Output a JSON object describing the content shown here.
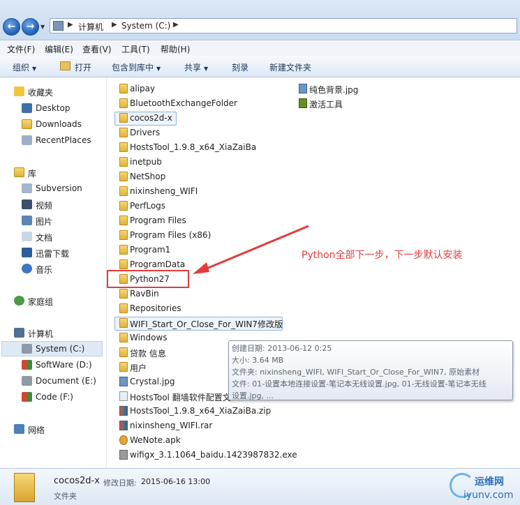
{
  "address": {
    "breadcrumbs": [
      "计算机",
      "System (C:)"
    ]
  },
  "menu": [
    "文件(F)",
    "编辑(E)",
    "查看(V)",
    "工具(T)",
    "帮助(H)"
  ],
  "commands": {
    "organize": "组织",
    "open": "打开",
    "include": "包含到库中",
    "share": "共享",
    "burn": "刻录",
    "newfolder": "新建文件夹"
  },
  "nav": {
    "favorites": "收藏夹",
    "desktop": "Desktop",
    "downloads": "Downloads",
    "recent": "RecentPlaces",
    "libraries": "库",
    "subversion": "Subversion",
    "video": "视频",
    "pictures": "图片",
    "docs": "文档",
    "xunlei": "迅雷下载",
    "music": "音乐",
    "homegroup": "家庭组",
    "computer": "计算机",
    "system": "System (C:)",
    "software": "SoftWare (D:)",
    "document": "Document (E:)",
    "code": "Code (F:)",
    "network": "网络"
  },
  "files_col1": [
    {
      "name": "alipay",
      "type": "folder"
    },
    {
      "name": "BluetoothExchangeFolder",
      "type": "folder"
    },
    {
      "name": "cocos2d-x",
      "type": "folder"
    },
    {
      "name": "Drivers",
      "type": "folder"
    },
    {
      "name": "HostsTool_1.9.8_x64_XiaZaiBa",
      "type": "folder"
    },
    {
      "name": "inetpub",
      "type": "folder"
    },
    {
      "name": "NetShop",
      "type": "folder"
    },
    {
      "name": "nixinsheng_WIFI",
      "type": "folder"
    },
    {
      "name": "PerfLogs",
      "type": "folder"
    },
    {
      "name": "Program Files",
      "type": "folder"
    },
    {
      "name": "Program Files (x86)",
      "type": "folder"
    },
    {
      "name": "Program1",
      "type": "folder"
    },
    {
      "name": "ProgramData",
      "type": "folder"
    },
    {
      "name": "Python27",
      "type": "folder"
    },
    {
      "name": "RavBin",
      "type": "folder"
    },
    {
      "name": "Repositories",
      "type": "folder"
    },
    {
      "name": "WIFI_Start_Or_Close_For_WIN7修改版",
      "type": "folder"
    },
    {
      "name": "Windows",
      "type": "folder"
    },
    {
      "name": "贷款 信息",
      "type": "folder"
    },
    {
      "name": "用户",
      "type": "folder"
    },
    {
      "name": "Crystal.jpg",
      "type": "jpg"
    },
    {
      "name": "HostsTool 翻墙软件配置文",
      "type": "txt"
    },
    {
      "name": "HostsTool_1.9.8_x64_XiaZaiBa.zip",
      "type": "zip"
    },
    {
      "name": "nixinsheng_WIFI.rar",
      "type": "zip"
    },
    {
      "name": "WeNote.apk",
      "type": "apk"
    },
    {
      "name": "wifigx_3.1.1064_baidu.1423987832.exe",
      "type": "exe"
    }
  ],
  "files_col2": [
    {
      "name": "纯色背景.jpg",
      "type": "jpg"
    },
    {
      "name": "激活工具",
      "type": "tool"
    }
  ],
  "annotation": "Python全部下一步，下一步默认安装",
  "tooltip": {
    "created": "创建日期: 2013-06-12 0:25",
    "size": "大小: 3.64 MB",
    "folders": "文件夹: nixinsheng_WIFI, WIFI_Start_Or_Close_For_WIN7, 原始素材",
    "files": "文件: 01-设置本地连接设置-笔记本无线设置.jpg, 01-无线设置-笔记本无线",
    "files2": "设置.jpg, ..."
  },
  "details": {
    "name": "cocos2d-x",
    "modified_label": "修改日期:",
    "modified_value": "2015-06-16 13:00",
    "type": "文件夹"
  },
  "watermark": {
    "line1": "运维网",
    "line2": "iyunv.com"
  },
  "colors": {
    "annotation_red": "#e53a3a",
    "selection_blue": "#dfe9f5",
    "folder_yellow": "#f7d774"
  }
}
